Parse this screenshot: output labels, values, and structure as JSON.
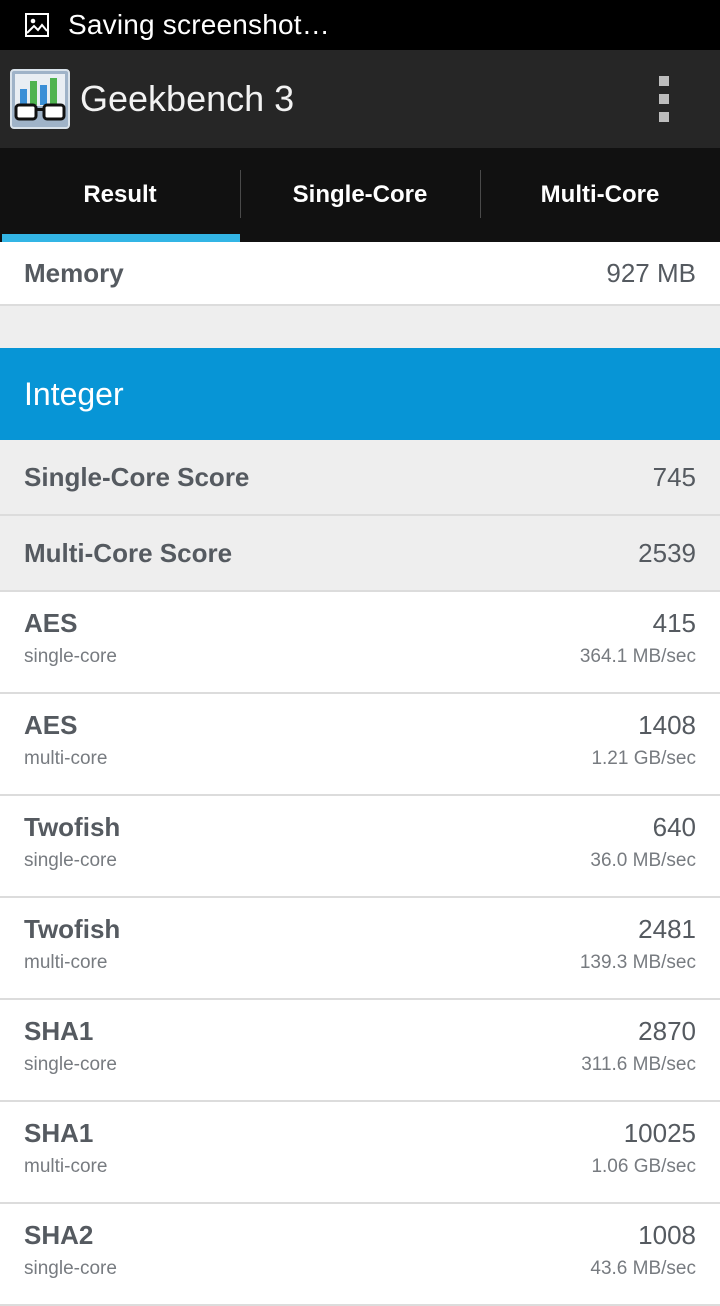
{
  "status_bar": {
    "text": "Saving screenshot…",
    "icon": "image-icon"
  },
  "app_bar": {
    "title": "Geekbench 3",
    "logo_icon": "geekbench-logo-icon",
    "menu_icon": "overflow-menu-icon"
  },
  "tabs": [
    {
      "label": "Result",
      "selected": true
    },
    {
      "label": "Single-Core",
      "selected": false
    },
    {
      "label": "Multi-Core",
      "selected": false
    }
  ],
  "memory": {
    "label": "Memory",
    "value": "927 MB"
  },
  "section": {
    "title": "Integer"
  },
  "scores": [
    {
      "label": "Single-Core Score",
      "value": "745"
    },
    {
      "label": "Multi-Core Score",
      "value": "2539"
    }
  ],
  "benchmarks": [
    {
      "name": "AES",
      "mode": "single-core",
      "score": "415",
      "rate": "364.1 MB/sec"
    },
    {
      "name": "AES",
      "mode": "multi-core",
      "score": "1408",
      "rate": "1.21 GB/sec"
    },
    {
      "name": "Twofish",
      "mode": "single-core",
      "score": "640",
      "rate": "36.0 MB/sec"
    },
    {
      "name": "Twofish",
      "mode": "multi-core",
      "score": "2481",
      "rate": "139.3 MB/sec"
    },
    {
      "name": "SHA1",
      "mode": "single-core",
      "score": "2870",
      "rate": "311.6 MB/sec"
    },
    {
      "name": "SHA1",
      "mode": "multi-core",
      "score": "10025",
      "rate": "1.06 GB/sec"
    },
    {
      "name": "SHA2",
      "mode": "single-core",
      "score": "1008",
      "rate": "43.6 MB/sec"
    }
  ],
  "colors": {
    "accent": "#0795d6",
    "tab_indicator": "#33b5e5",
    "tabs_bg": "#111111",
    "appbar_bg": "#262626"
  }
}
